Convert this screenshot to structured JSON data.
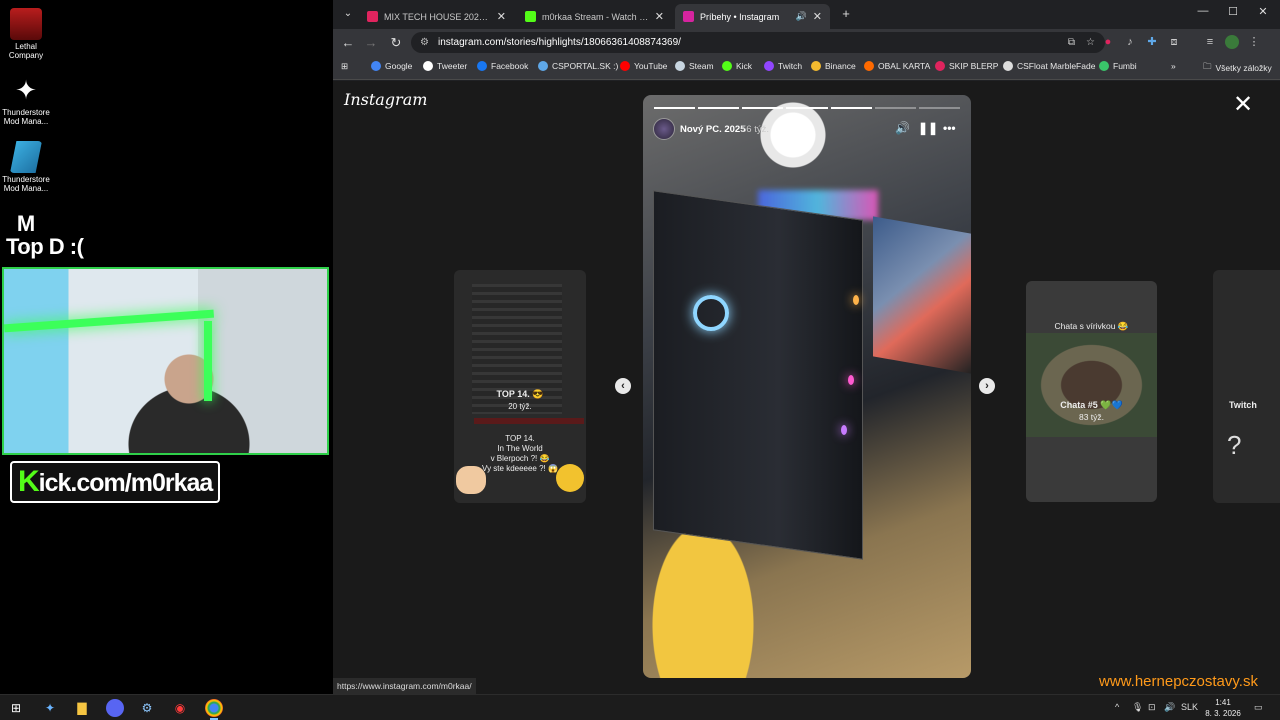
{
  "desktop": {
    "icons": [
      {
        "label": "Lethal Company"
      },
      {
        "label": "Thunderstore Mod Mana..."
      },
      {
        "label": "Thunderstore Mod Mana..."
      },
      {
        "label": "Map"
      }
    ],
    "overlay_title": "Top D :(",
    "kick_banner": {
      "k": "K",
      "rest": "ick.com/m0rkaa"
    }
  },
  "browser": {
    "tabs": [
      {
        "title": "MIX TECH HOUSE 2021 #12 (Fi...",
        "color": "#e0245e"
      },
      {
        "title": "m0rkaa Stream - Watch Live on...",
        "color": "#53fc18"
      },
      {
        "title": "Príbehy • Instagram",
        "color": "#d6249f"
      }
    ],
    "new_tab": "+",
    "url": "instagram.com/stories/highlights/18066361408874369/",
    "bookmarks": [
      {
        "label": "Google",
        "color": "#4285f4"
      },
      {
        "label": "Tweeter",
        "color": "#ffffff"
      },
      {
        "label": "Facebook",
        "color": "#1877f2"
      },
      {
        "label": "CSPORTAL.SK :)",
        "color": "#5fa8e8"
      },
      {
        "label": "YouTube",
        "color": "#ff0000"
      },
      {
        "label": "Steam",
        "color": "#c7d5e0"
      },
      {
        "label": "Kick",
        "color": "#53fc18"
      },
      {
        "label": "Twitch",
        "color": "#9146ff"
      },
      {
        "label": "Binance",
        "color": "#f3ba2f"
      },
      {
        "label": "OBAL KARTA",
        "color": "#ff6a00"
      },
      {
        "label": "SKIP BLERP",
        "color": "#e0245e"
      },
      {
        "label": "CSFloat MarbleFade",
        "color": "#dddddd"
      },
      {
        "label": "Fumbi",
        "color": "#3ac46a"
      }
    ],
    "bookmarks_more": "»",
    "all_bookmarks": "Všetky záložky",
    "status_url": "https://www.instagram.com/m0rkaa/"
  },
  "instagram": {
    "logo": "Instagram",
    "close": "✕",
    "story": {
      "title": "Nový PC. 2025",
      "age": "56 týž.",
      "segments_total": 7,
      "segments_done": 5
    },
    "left_preview": {
      "title": "TOP 14. 😎",
      "age": "20 týž.",
      "line1": "TOP 14.",
      "line2": "In The World",
      "line3": "v Blerpoch ?! 😂",
      "line4": "Vy ste kdeeeee ?! 😱"
    },
    "right_preview": {
      "caption": "Chata s vírivkou 😂",
      "title": "Chata #5 💚💙",
      "age": "83 týž."
    },
    "far_preview": {
      "title": "Twitch",
      "mark": "?"
    },
    "prev_arrow": "‹",
    "next_arrow": "›",
    "watermark": "www.hernepczostavy.sk"
  },
  "taskbar": {
    "lang": "SLK",
    "time": "1:41",
    "date": "8. 3. 2026"
  }
}
